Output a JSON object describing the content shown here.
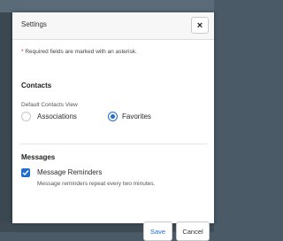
{
  "dialog": {
    "title": "Settings",
    "close_label": "×",
    "required_asterisk": "*",
    "required_text": "Required fields are marked with an asterisk."
  },
  "contacts": {
    "heading": "Contacts",
    "default_view_label": "Default Contacts View",
    "options": [
      {
        "label": "Associations",
        "selected": false
      },
      {
        "label": "Favorites",
        "selected": true
      }
    ]
  },
  "messages": {
    "heading": "Messages",
    "reminders_label": "Message Reminders",
    "reminders_checked": true,
    "reminders_help": "Message reminders repeat every two minutes."
  },
  "footer": {
    "save_label": "Save",
    "cancel_label": "Cancel"
  },
  "colors": {
    "accent": "#1f6fd1",
    "required": "#d21f1f"
  }
}
